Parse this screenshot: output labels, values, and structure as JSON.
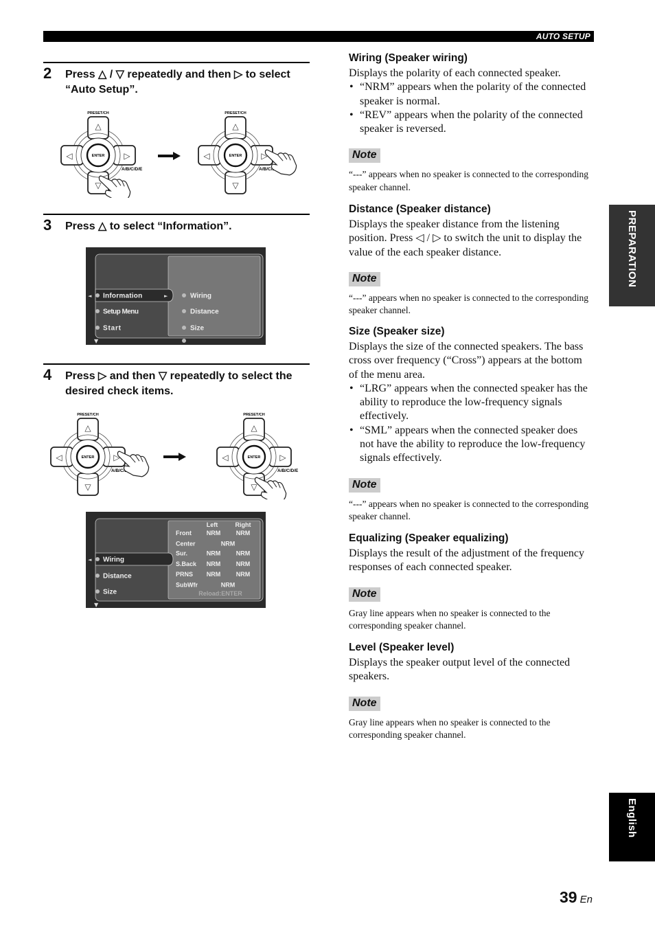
{
  "header": {
    "section_label": "AUTO SETUP"
  },
  "side_tabs": {
    "preparation": "PREPARATION",
    "language": "English"
  },
  "page": {
    "number": "39",
    "suffix": "En"
  },
  "steps": [
    {
      "number": "2",
      "text": "Press △ / ▽ repeatedly and then ▷ to select “Auto Setup”."
    },
    {
      "number": "3",
      "text": "Press △ to select “Information”."
    },
    {
      "number": "4",
      "text": "Press ▷ and then ▽ repeatedly to select the desired check items."
    }
  ],
  "remote": {
    "top_label": "PRESET/CH",
    "center_label": "ENTER",
    "side_label": "A/B/C/D/E",
    "up_glyph": "△",
    "down_glyph": "▽",
    "left_glyph": "◁",
    "right_glyph": "▷"
  },
  "osd_info": {
    "left_menu": [
      "Information",
      "Setup Menu",
      "Start"
    ],
    "selected_index": 0,
    "right_menu": [
      "Wiring",
      "Distance",
      "Size"
    ]
  },
  "osd_wiring": {
    "left_menu": [
      "Wiring",
      "Distance",
      "Size"
    ],
    "selected_index": 0,
    "col_headers": [
      "Left",
      "Right"
    ],
    "rows": [
      {
        "label": "Front",
        "left": "NRM",
        "right": "NRM"
      },
      {
        "label": "Center",
        "center": "NRM"
      },
      {
        "label": "Sur.",
        "left": "NRM",
        "right": "NRM"
      },
      {
        "label": "S.Back",
        "left": "NRM",
        "right": "NRM"
      },
      {
        "label": "PRNS",
        "left": "NRM",
        "right": "NRM"
      },
      {
        "label": "SubWfr",
        "center": "NRM"
      }
    ],
    "footer": "Reload:ENTER"
  },
  "sections": {
    "wiring": {
      "title": "Wiring (Speaker wiring)",
      "body": "Displays the polarity of each connected speaker.",
      "bullets": [
        "“NRM” appears when the polarity of the connected speaker is normal.",
        "“REV” appears when the polarity of the connected speaker is reversed."
      ],
      "note_label": "Note",
      "note": "“---” appears when no speaker is connected to the corresponding speaker channel."
    },
    "distance": {
      "title": "Distance (Speaker distance)",
      "body": "Displays the speaker distance from the listening position. Press ◁ / ▷ to switch the unit to display the value of the each speaker distance.",
      "note_label": "Note",
      "note": "“---” appears when no speaker is connected to the corresponding speaker channel."
    },
    "size": {
      "title": "Size (Speaker size)",
      "body": "Displays the size of the connected speakers. The bass cross over frequency (“Cross”) appears at the bottom of the menu area.",
      "bullets": [
        "“LRG” appears when the connected speaker has the ability to reproduce the low-frequency signals effectively.",
        "“SML” appears when the connected speaker does not have the ability to reproduce the low-frequency signals effectively."
      ],
      "note_label": "Note",
      "note": "“---” appears when no speaker is connected to the corresponding speaker channel."
    },
    "equalizing": {
      "title": "Equalizing (Speaker equalizing)",
      "body": "Displays the result of the adjustment of the frequency responses of each connected speaker.",
      "note_label": "Note",
      "note": "Gray line appears when no speaker is connected to the corresponding speaker channel."
    },
    "level": {
      "title": "Level (Speaker level)",
      "body": "Displays the speaker output level of the connected speakers.",
      "note_label": "Note",
      "note": "Gray line appears when no speaker is connected to the corresponding speaker channel."
    }
  }
}
